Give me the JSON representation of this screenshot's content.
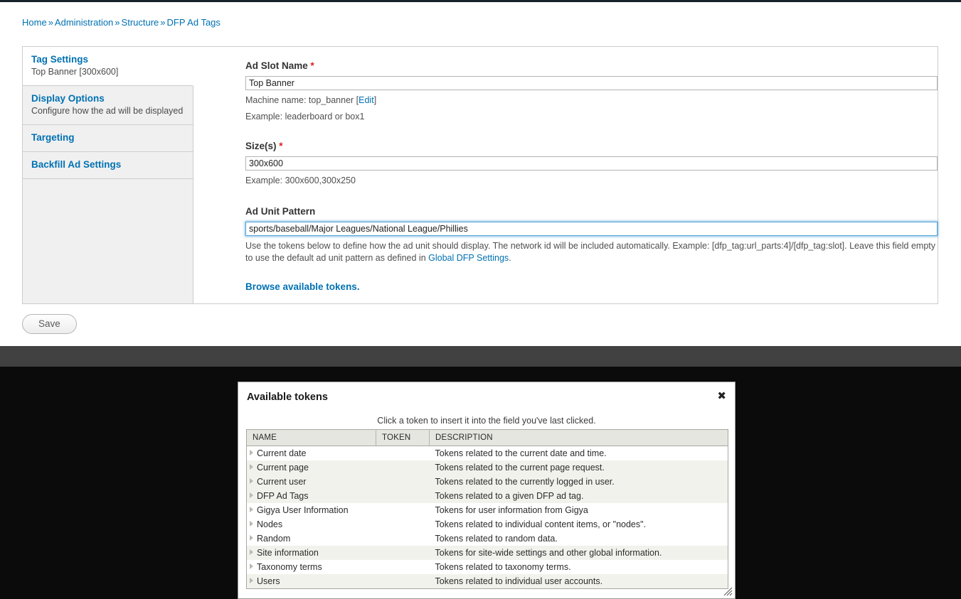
{
  "breadcrumb": {
    "separator": "»",
    "items": [
      {
        "label": "Home"
      },
      {
        "label": "Administration"
      },
      {
        "label": "Structure"
      },
      {
        "label": "DFP Ad Tags"
      }
    ]
  },
  "vertical_tabs": [
    {
      "title": "Tag Settings",
      "summary": "Top Banner [300x600]",
      "active": true
    },
    {
      "title": "Display Options",
      "summary": "Configure how the ad will be displayed",
      "active": false
    },
    {
      "title": "Targeting",
      "summary": "",
      "active": false
    },
    {
      "title": "Backfill Ad Settings",
      "summary": "",
      "active": false
    }
  ],
  "form": {
    "ad_slot_name": {
      "label": "Ad Slot Name",
      "required_marker": "*",
      "value": "Top Banner",
      "machine_name_prefix": "Machine name: top_banner [",
      "machine_name_edit": "Edit",
      "machine_name_suffix": "]",
      "example": "Example: leaderboard or box1"
    },
    "sizes": {
      "label": "Size(s)",
      "required_marker": "*",
      "value": "300x600",
      "example": "Example: 300x600,300x250"
    },
    "ad_unit_pattern": {
      "label": "Ad Unit Pattern",
      "value": "sports/baseball/Major Leagues/National League/Phillies",
      "description_part1": "Use the tokens below to define how the ad unit should display. The network id will be included automatically. Example: [dfp_tag:url_parts:4]/[dfp_tag:slot]. Leave this field empty to use the default ad unit pattern as defined in ",
      "description_link": "Global DFP Settings",
      "description_part2": ".",
      "browse_link": "Browse available tokens."
    },
    "save_label": "Save"
  },
  "modal": {
    "title": "Available tokens",
    "close_icon": "✖",
    "hint": "Click a token to insert it into the field you've last clicked.",
    "columns": [
      "NAME",
      "TOKEN",
      "DESCRIPTION"
    ],
    "rows": [
      {
        "name": "Current date",
        "token": "",
        "description": "Tokens related to the current date and time.",
        "shade": false
      },
      {
        "name": "Current page",
        "token": "",
        "description": "Tokens related to the current page request.",
        "shade": true
      },
      {
        "name": "Current user",
        "token": "",
        "description": "Tokens related to the currently logged in user.",
        "shade": true
      },
      {
        "name": "DFP Ad Tags",
        "token": "",
        "description": "Tokens related to a given DFP ad tag.",
        "shade": true
      },
      {
        "name": "Gigya User Information",
        "token": "",
        "description": "Tokens for user information from Gigya",
        "shade": false
      },
      {
        "name": "Nodes",
        "token": "",
        "description": "Tokens related to individual content items, or \"nodes\".",
        "shade": false
      },
      {
        "name": "Random",
        "token": "",
        "description": "Tokens related to random data.",
        "shade": false
      },
      {
        "name": "Site information",
        "token": "",
        "description": "Tokens for site-wide settings and other global information.",
        "shade": true
      },
      {
        "name": "Taxonomy terms",
        "token": "",
        "description": "Tokens related to taxonomy terms.",
        "shade": false
      },
      {
        "name": "Users",
        "token": "",
        "description": "Tokens related to individual user accounts.",
        "shade": true
      }
    ]
  },
  "colors": {
    "link": "#0071b3",
    "required": "#e01b1b",
    "focus_ring": "#5aa6d8",
    "tab_inactive_bg": "#f0f0f0",
    "band_gray": "#414141",
    "band_black": "#0b0b0b",
    "row_shade": "#f2f2ed",
    "table_header_bg": "#e6e6e0"
  }
}
